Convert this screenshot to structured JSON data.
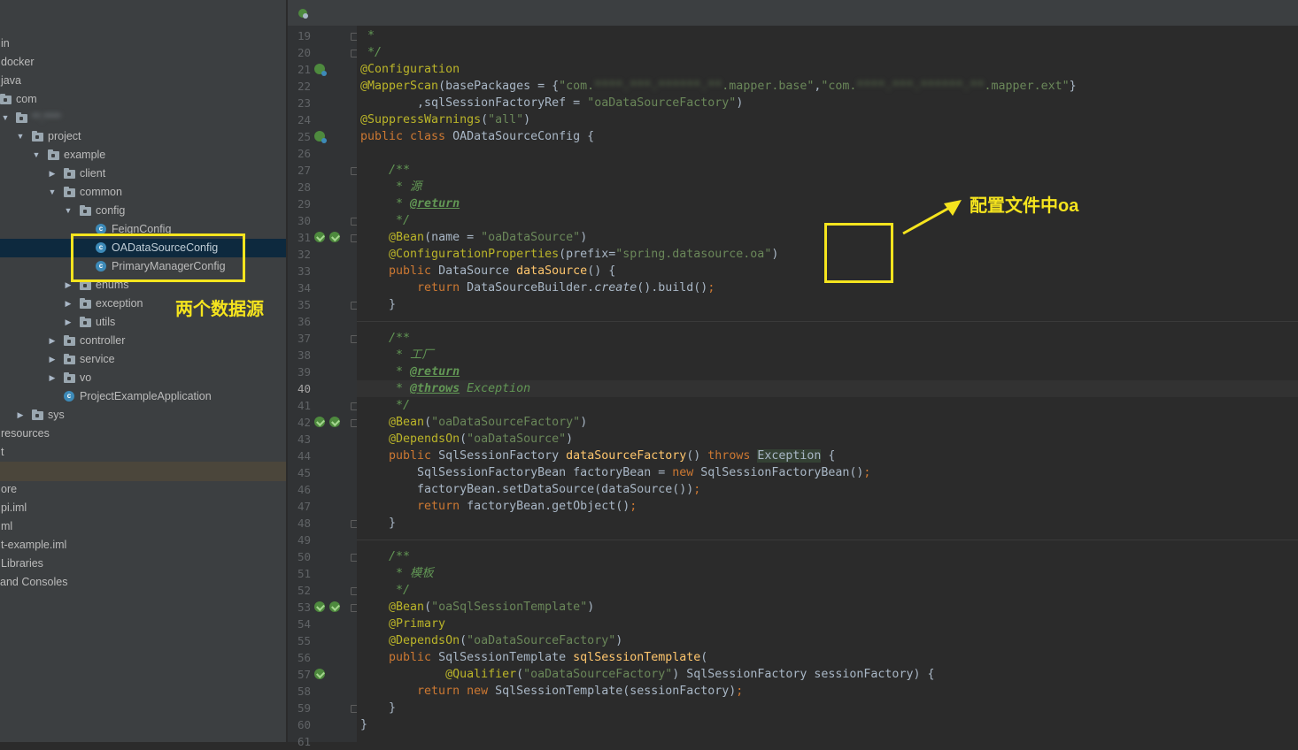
{
  "tree": {
    "rows": [
      {
        "label": "in"
      },
      {
        "label": "docker"
      },
      {
        "label": "java"
      },
      {
        "label": "com"
      },
      {
        "label": "**.****"
      },
      {
        "label": "project"
      },
      {
        "label": "example"
      },
      {
        "label": "client"
      },
      {
        "label": "common"
      },
      {
        "label": "config"
      },
      {
        "label": "FeignConfig"
      },
      {
        "label": "OADataSourceConfig"
      },
      {
        "label": "PrimaryManagerConfig"
      },
      {
        "label": "enums"
      },
      {
        "label": "exception"
      },
      {
        "label": "utils"
      },
      {
        "label": "controller"
      },
      {
        "label": "service"
      },
      {
        "label": "vo"
      },
      {
        "label": "ProjectExampleApplication"
      },
      {
        "label": "sys"
      },
      {
        "label": "resources"
      },
      {
        "label": "t"
      },
      {
        "label": "ore"
      },
      {
        "label": "pi.iml"
      },
      {
        "label": "ml"
      },
      {
        "label": "t-example.iml"
      },
      {
        "label": "Libraries"
      },
      {
        "label": " and Consoles"
      }
    ]
  },
  "editor": {
    "line_numbers": [
      "19",
      "20",
      "21",
      "22",
      "23",
      "24",
      "25",
      "26",
      "27",
      "28",
      "29",
      "30",
      "31",
      "32",
      "33",
      "34",
      "35",
      "36",
      "37",
      "38",
      "39",
      "40",
      "41",
      "42",
      "43",
      "44",
      "45",
      "46",
      "47",
      "48",
      "49",
      "50",
      "51",
      "52",
      "53",
      "54",
      "55",
      "56",
      "57",
      "58",
      "59",
      "60",
      "61"
    ],
    "current_line": "40",
    "code": {
      "l19": " *",
      "l20": " */",
      "l21": "@Configuration",
      "l22_a": "@MapperScan",
      "l22_b": "(basePackages = {",
      "l22_c": "\"com.",
      "l22_d": "****.***.******.**",
      "l22_e": ".mapper.base\"",
      "l22_f": ",",
      "l22_g": "\"com.",
      "l22_h": "****.***.******.**",
      "l22_i": ".mapper.ext\"",
      "l22_j": "}",
      "l23_a": "        ,sqlSessionFactoryRef = ",
      "l23_b": "\"oaDataSourceFactory\"",
      "l23_c": ")",
      "l24_a": "@SuppressWarnings",
      "l24_b": "(",
      "l24_c": "\"all\"",
      "l24_d": ")",
      "l25_a": "public class ",
      "l25_b": "OADataSourceConfig {",
      "l27": "    /**",
      "l28": "     * 源",
      "l29_a": "     * ",
      "l29_b": "@return",
      "l30": "     */",
      "l31_a": "    @Bean",
      "l31_b": "(name = ",
      "l31_c": "\"oaDataSource\"",
      "l31_d": ")",
      "l32_a": "    @ConfigurationProperties",
      "l32_b": "(prefix=",
      "l32_c": "\"spring.datasource.oa\"",
      "l32_d": ")",
      "l33_a": "    public ",
      "l33_b": "DataSource ",
      "l33_c": "dataSource",
      "l33_d": "() {",
      "l34_a": "        return ",
      "l34_b": "DataSourceBuilder.",
      "l34_c": "create",
      "l34_d": "().build()",
      "l34_e": ";",
      "l35": "    }",
      "l37": "    /**",
      "l38": "     * 工厂",
      "l39_a": "     * ",
      "l39_b": "@return",
      "l40_a": "     * ",
      "l40_b": "@throws",
      "l40_c": " ",
      "l40_d": "Exception",
      "l41": "     */",
      "l42_a": "    @Bean",
      "l42_b": "(",
      "l42_c": "\"oaDataSourceFactory\"",
      "l42_d": ")",
      "l43_a": "    @DependsOn",
      "l43_b": "(",
      "l43_c": "\"oaDataSource\"",
      "l43_d": ")",
      "l44_a": "    public ",
      "l44_b": "SqlSessionFactory ",
      "l44_c": "dataSourceFactory",
      "l44_d": "() ",
      "l44_e": "throws ",
      "l44_f": "Exception",
      "l44_g": " {",
      "l45_a": "        SqlSessionFactoryBean factoryBean = ",
      "l45_b": "new ",
      "l45_c": "SqlSessionFactoryBean()",
      "l45_d": ";",
      "l46_a": "        factoryBean.setDataSource(dataSource())",
      "l46_b": ";",
      "l47_a": "        return ",
      "l47_b": "factoryBean.getObject()",
      "l47_c": ";",
      "l48": "    }",
      "l50": "    /**",
      "l51": "     * 模板",
      "l52": "     */",
      "l53_a": "    @Bean",
      "l53_b": "(",
      "l53_c": "\"oaSqlSessionTemplate\"",
      "l53_d": ")",
      "l54": "    @Primary",
      "l55_a": "    @DependsOn",
      "l55_b": "(",
      "l55_c": "\"oaDataSourceFactory\"",
      "l55_d": ")",
      "l56_a": "    public ",
      "l56_b": "SqlSessionTemplate ",
      "l56_c": "sqlSessionTemplate",
      "l56_d": "(",
      "l57_a": "            @Qualifier",
      "l57_b": "(",
      "l57_c": "\"oaDataSourceFactory\"",
      "l57_d": ") SqlSessionFactory sessionFactory) {",
      "l58_a": "        return new ",
      "l58_b": "SqlSessionTemplate(sessionFactory)",
      "l58_c": ";",
      "l59": "    }",
      "l60": "}"
    }
  },
  "annotations": {
    "two_datasources": "两个数据源",
    "config_oa": "配置文件中oa",
    "color": "#f5e41e"
  },
  "icons": [
    "folder-icon",
    "java-class-icon",
    "spring-bean-gutter-icon",
    "spring-config-gutter-icon",
    "fold-marker-icon",
    "pin-icon"
  ]
}
